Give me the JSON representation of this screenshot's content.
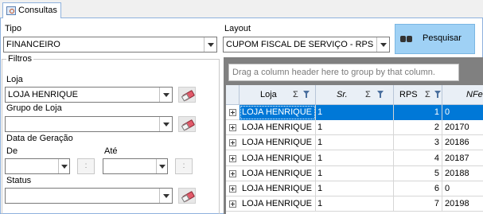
{
  "tab": {
    "label": "Consultas"
  },
  "tipo": {
    "label": "Tipo",
    "value": "FINANCEIRO"
  },
  "layout": {
    "label": "Layout",
    "value": "CUPOM FISCAL DE SERVIÇO - RPS"
  },
  "search_button": {
    "label": "Pesquisar",
    "icon": "binoculars-icon"
  },
  "filtros": {
    "title": "Filtros",
    "loja": {
      "label": "Loja",
      "value": "LOJA HENRIQUE"
    },
    "grupo_loja": {
      "label": "Grupo de Loja",
      "value": ""
    },
    "data_geracao": {
      "label": "Data de Geração",
      "de_label": "De",
      "ate_label": "Até",
      "time_placeholder": ":"
    },
    "status": {
      "label": "Status",
      "value": ""
    }
  },
  "grid": {
    "group_hint": "Drag a column header here to group by that column.",
    "columns": [
      {
        "label": "Loja",
        "sum": "Σ"
      },
      {
        "label": "Sr.",
        "sum": "Σ"
      },
      {
        "label": "RPS",
        "sum": "Σ"
      },
      {
        "label": "NFe",
        "sum": ""
      }
    ],
    "rows": [
      {
        "loja": "LOJA HENRIQUE",
        "sr": "1",
        "rps": "1",
        "nfe": "0",
        "selected": true
      },
      {
        "loja": "LOJA HENRIQUE",
        "sr": "1",
        "rps": "2",
        "nfe": "20170",
        "selected": false
      },
      {
        "loja": "LOJA HENRIQUE",
        "sr": "1",
        "rps": "3",
        "nfe": "20186",
        "selected": false
      },
      {
        "loja": "LOJA HENRIQUE",
        "sr": "1",
        "rps": "4",
        "nfe": "20187",
        "selected": false
      },
      {
        "loja": "LOJA HENRIQUE",
        "sr": "1",
        "rps": "5",
        "nfe": "20188",
        "selected": false
      },
      {
        "loja": "LOJA HENRIQUE",
        "sr": "1",
        "rps": "6",
        "nfe": "0",
        "selected": false
      },
      {
        "loja": "LOJA HENRIQUE",
        "sr": "1",
        "rps": "7",
        "nfe": "20198",
        "selected": false
      }
    ]
  },
  "colors": {
    "selection": "#0078d7",
    "button_bg": "#9fd1f5",
    "header_bg": "#e9eff6",
    "border_blue": "#8eb1dd"
  }
}
